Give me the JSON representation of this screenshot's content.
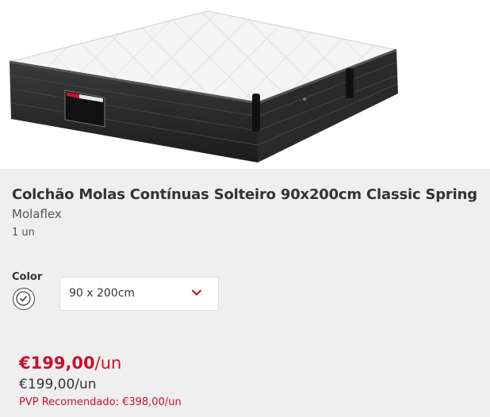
{
  "product": {
    "title": "Colchão Molas Contínuas Solteiro 90x200cm Classic Spring",
    "brand": "Molaflex",
    "quantity": "1 un",
    "image_alt": "mattress-product-image",
    "label_text": "CLASSIC SPRING"
  },
  "variant": {
    "label": "Color",
    "selected_size": "90 x 200cm",
    "swatch_icon": "checkmark-circle-icon",
    "dropdown_icon": "chevron-down-icon"
  },
  "pricing": {
    "price": "€199,00",
    "price_unit": "/un",
    "reference_price": "€199,00/un",
    "pvp_label": "PVP Recomendado: €398,00/un"
  },
  "colors": {
    "accent": "#c8102e",
    "panel_bg": "#efefef",
    "text": "#333333"
  }
}
